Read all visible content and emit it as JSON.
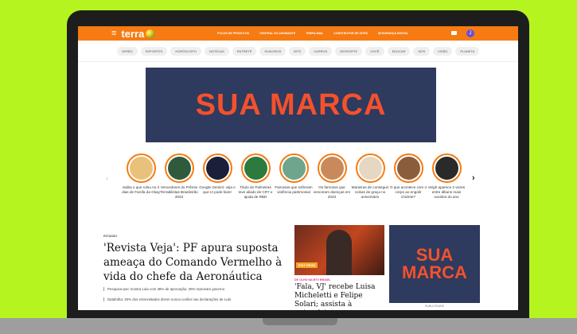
{
  "header": {
    "logo_text": "terra",
    "nav_links": [
      "FOCOS DE PRODUTOS",
      "CENTRAL DO ASSINANTE",
      "TERRA MAIL",
      "CONSTRUTOR DE SITES",
      "SEGURANÇA DIGITAL"
    ],
    "avatar_initial": "J",
    "accent_color": "#f57b12"
  },
  "subnav": [
    "VERÃO",
    "ESPORTES",
    "HORÓSCOPO",
    "NOTÍCIAS",
    "ENTRETÊ",
    "DIVAGROS",
    "BITS",
    "CARROS",
    "DESPORTE",
    "VOCÊ",
    "EDUCAR",
    "NÓS",
    "VISÃO",
    "PLANETA"
  ],
  "banner_ad": {
    "text": "SUA MARCA",
    "bg_color": "#2e3a5e",
    "text_color": "#f4512c"
  },
  "stories": [
    {
      "caption": "Saiba o que rolou no 3 dias de Farofa da Gkay",
      "color": "#e8c27a"
    },
    {
      "caption": "Vencedores do Prêmio Terrabilistas Brasileirão 2023",
      "color": "#2f5a3c"
    },
    {
      "caption": "Google Gemini: veja o que IA pode fazer",
      "color": "#1b1f3a"
    },
    {
      "caption": "Título do Palmeiras teve aliado de CR7 e ajuda de RBD",
      "color": "#2c7a3d"
    },
    {
      "caption": "Famosas que sofreram violência patrimonial",
      "color": "#6fa58c"
    },
    {
      "caption": "Os famosos que venceram doenças em 2023",
      "color": "#c88a5a"
    },
    {
      "caption": "Maneiras de conseguir coisas de graça no aniversário",
      "color": "#e6d7c2"
    },
    {
      "caption": "O que acontece com o corpo ao engolir chiclete?",
      "color": "#8a5e3c"
    },
    {
      "caption": "Veigh aparece 2 vezes entre álbuns mais ouvidos do ano",
      "color": "#2a2a2a"
    }
  ],
  "main_story": {
    "kicker": "ESTADÃO",
    "headline": "'Revista Veja': PF apura suposta ameaça do Comando Vermelho à vida do chefe da Aeronáutica",
    "bullets": [
      "Pesquisa Ipec mostra Lula com 38% de aprovação; 30% reprovam governo",
      "Datafolha: 40% dos entrevistados dizem nunca confiar nas declarações de Lula"
    ]
  },
  "card": {
    "badge": "EXIT PEGE",
    "tag": "DE OLHO NA MTV BRASIL",
    "title": "'Fala, VJ' recebe Luisa Micheletti e Felipe Solari; assista à entrevista"
  },
  "side_ad": {
    "line1": "SUA",
    "line2": "MARCA",
    "label": "PUBLICIDADE"
  }
}
